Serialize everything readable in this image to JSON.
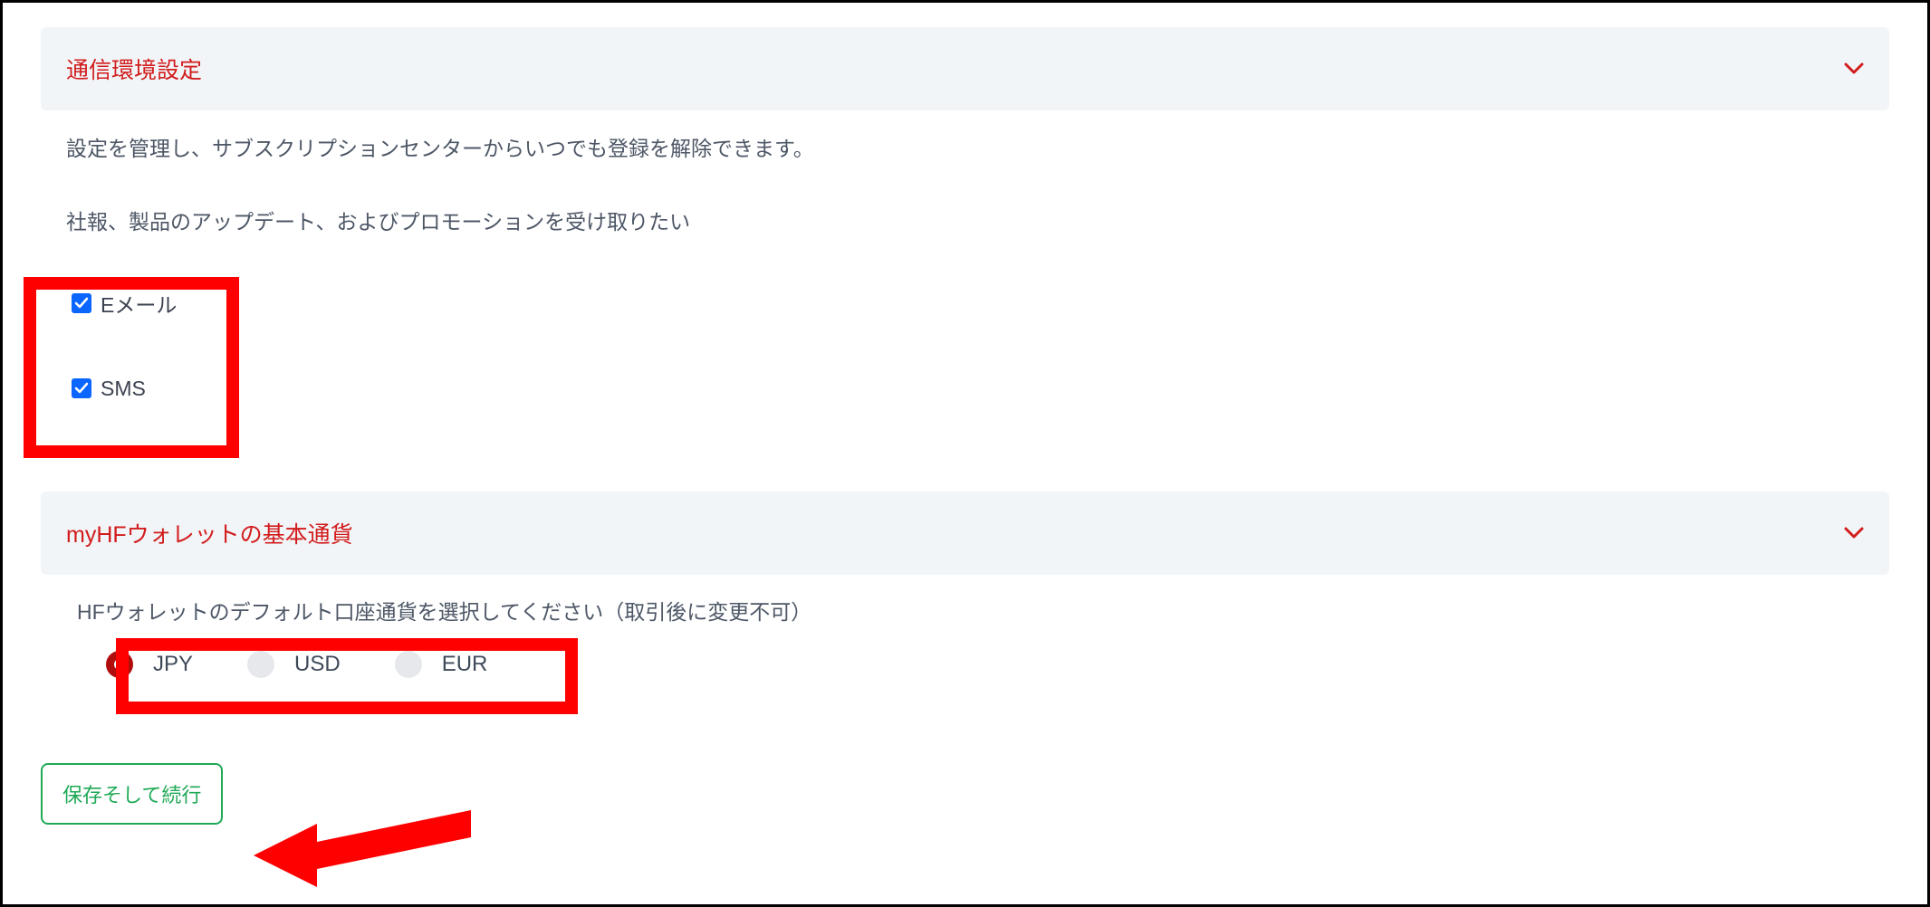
{
  "sections": {
    "communication": {
      "title": "通信環境設定",
      "desc1": "設定を管理し、サブスクリプションセンターからいつでも登録を解除できます。",
      "desc2": "社報、製品のアップデート、およびプロモーションを受け取りたい",
      "checkboxes": {
        "email": {
          "label": "Eメール",
          "checked": true
        },
        "sms": {
          "label": "SMS",
          "checked": true
        }
      }
    },
    "wallet": {
      "title": "myHFウォレットの基本通貨",
      "desc": "HFウォレットのデフォルト口座通貨を選択してください（取引後に変更不可）",
      "radios": {
        "jpy": {
          "label": "JPY",
          "selected": true
        },
        "usd": {
          "label": "USD",
          "selected": false
        },
        "eur": {
          "label": "EUR",
          "selected": false
        }
      }
    }
  },
  "buttons": {
    "save": "保存そして続行"
  },
  "annotations": {
    "highlight_checkboxes": true,
    "highlight_radios": true,
    "arrow_to_save": true
  },
  "colors": {
    "accent_red": "#d21c1c",
    "highlight_red": "#ff0000",
    "checkbox_blue": "#0a66ff",
    "radio_selected": "#b00d0d",
    "button_green": "#1fa956",
    "header_bg": "#f2f5f8",
    "text_body": "#4d5766"
  }
}
